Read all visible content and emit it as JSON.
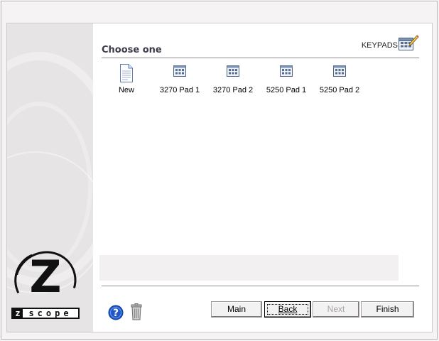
{
  "header": {
    "title": "Choose one",
    "keypads_label": "KEYPADS",
    "keypads_icon": "keypad-edit-icon"
  },
  "items": [
    {
      "label": "New",
      "icon": "blank-document-icon"
    },
    {
      "label": "3270 Pad 1",
      "icon": "keypad-icon"
    },
    {
      "label": "3270 Pad 2",
      "icon": "keypad-icon"
    },
    {
      "label": "5250 Pad 1",
      "icon": "keypad-icon"
    },
    {
      "label": "5250 Pad 2",
      "icon": "keypad-icon"
    }
  ],
  "logo": {
    "letter": "Z",
    "box_letter": "z",
    "brand_text": "scope"
  },
  "footer": {
    "help_icon": "help-icon",
    "trash_icon": "trash-icon",
    "buttons": {
      "main": "Main",
      "back": "Back",
      "next": "Next",
      "finish": "Finish"
    }
  },
  "colors": {
    "sidebar": "#e6e4e5",
    "title_text": "#3b3b4b",
    "help_blue": "#1f57c6",
    "disabled_text": "#a8a3a5"
  }
}
